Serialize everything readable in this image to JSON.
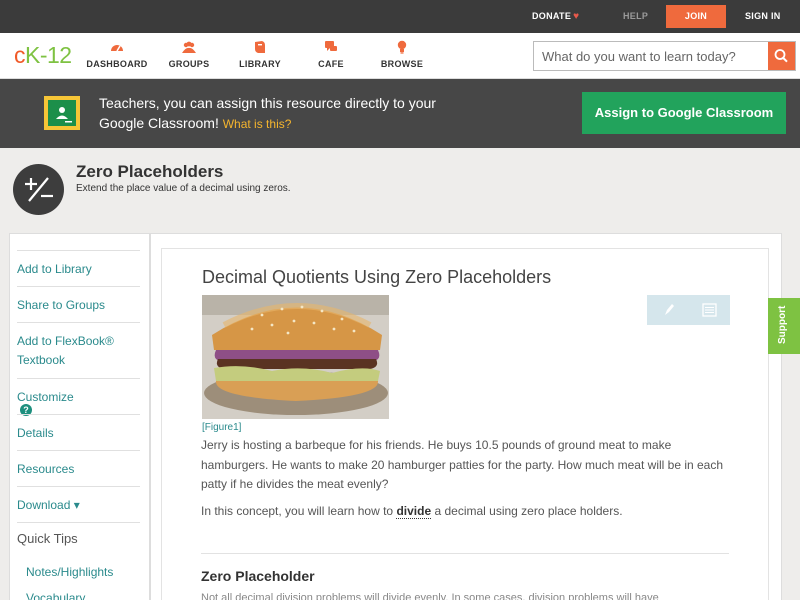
{
  "topbar": {
    "donate": "DONATE",
    "help": "HELP",
    "join": "JOIN",
    "signin": "SIGN IN"
  },
  "nav": {
    "logo_c": "c",
    "logo_k": "K",
    "logo_n": "-12",
    "items": [
      {
        "label": "DASHBOARD",
        "icon": "gauge-icon"
      },
      {
        "label": "GROUPS",
        "icon": "people-icon"
      },
      {
        "label": "LIBRARY",
        "icon": "book-icon"
      },
      {
        "label": "CAFE",
        "icon": "chat-bubbles-icon"
      },
      {
        "label": "BROWSE",
        "icon": "lightbulb-icon"
      }
    ],
    "search_placeholder": "What do you want to learn today?"
  },
  "banner": {
    "text": "Teachers, you can assign this resource directly to your Google Classroom!",
    "what": "What is this?",
    "assign_button": "Assign to Google Classroom"
  },
  "concept": {
    "title": "Zero Placeholders",
    "subtitle": "Extend the place value of a decimal using zeros."
  },
  "sidebar": {
    "links": [
      "Add to Library",
      "Share to Groups",
      "Add to FlexBook® Textbook",
      "Customize",
      "Details",
      "Resources",
      "Download ▾"
    ],
    "help_badge": "?",
    "quick_tips": "Quick Tips",
    "sub_links": [
      "Notes/Highlights",
      "Vocabulary"
    ]
  },
  "article": {
    "title": "Decimal Quotients Using Zero Placeholders",
    "figure_label": "[Figure1]",
    "intro": "Jerry is hosting a barbeque for his friends. He buys 10.5 pounds of ground meat to make hamburgers. He wants to make 20 hamburger patties for the party. How much meat will be in each patty if he divides the meat evenly?",
    "concept_before": "In this concept, you will learn how to ",
    "concept_term": "divide",
    "concept_after": " a decimal using zero place holders.",
    "section_heading": "Zero Placeholder",
    "cut_line": "Not all decimal division problems will divide evenly. In some cases, division problems will have"
  },
  "support": "Support",
  "colors": {
    "topbar": "#3b3b3b",
    "join": "#ef6a3d",
    "banner": "#474747",
    "assign": "#22a35c",
    "link": "#2a8a8c",
    "support": "#7ec242"
  }
}
